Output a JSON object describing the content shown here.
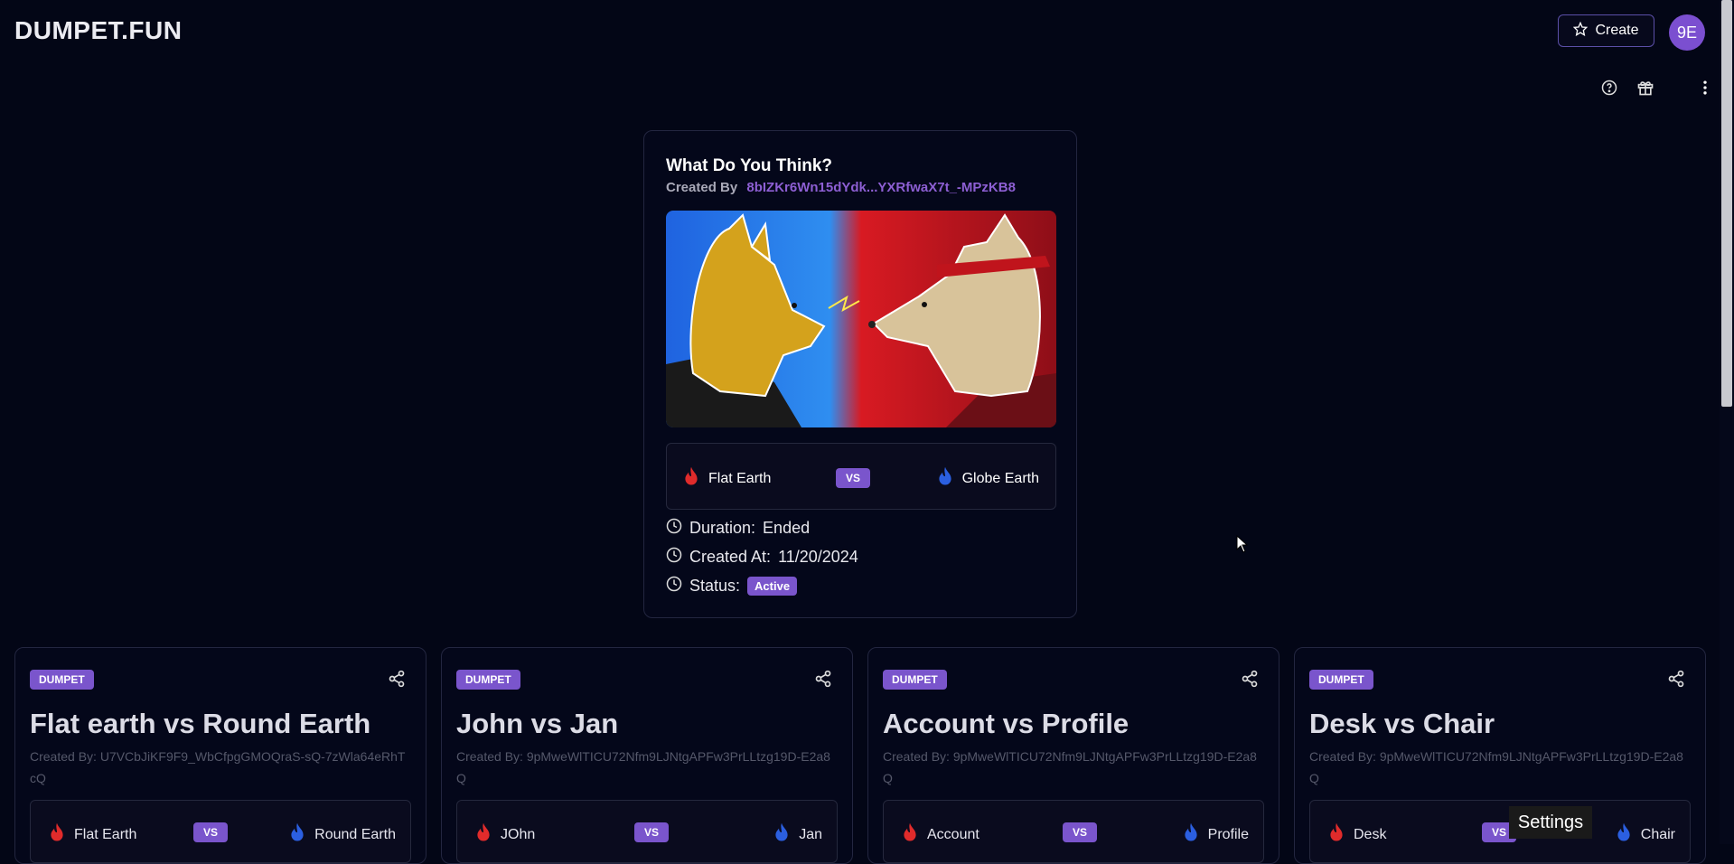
{
  "header": {
    "logo": "DUMPET.FUN",
    "create_label": "Create",
    "avatar_initials": "9E"
  },
  "feature": {
    "title": "What Do You Think?",
    "created_by_label": "Created By",
    "creator_address": "8bIZKr6Wn15dYdk...YXRfwaX7t_-MPzKB8",
    "left_option": "Flat Earth",
    "vs_label": "VS",
    "right_option": "Globe Earth",
    "duration_label": "Duration:",
    "duration_value": "Ended",
    "created_at_label": "Created At:",
    "created_at_value": "11/20/2024",
    "status_label": "Status:",
    "status_value": "Active"
  },
  "cards": [
    {
      "tag": "DUMPET",
      "title": "Flat earth vs Round Earth",
      "created_by": "Created By: U7VCbJiKF9F9_WbCfpgGMOQraS-sQ-7zWla64eRhTcQ",
      "left": "Flat Earth",
      "vs": "VS",
      "right": "Round Earth"
    },
    {
      "tag": "DUMPET",
      "title": "John vs Jan",
      "created_by": "Created By: 9pMweWlTICU72Nfm9LJNtgAPFw3PrLLtzg19D-E2a8Q",
      "left": "JOhn",
      "vs": "VS",
      "right": "Jan"
    },
    {
      "tag": "DUMPET",
      "title": "Account vs Profile",
      "created_by": "Created By: 9pMweWlTICU72Nfm9LJNtgAPFw3PrLLtzg19D-E2a8Q",
      "left": "Account",
      "vs": "VS",
      "right": "Profile"
    },
    {
      "tag": "DUMPET",
      "title": "Desk vs Chair",
      "created_by": "Created By: 9pMweWlTICU72Nfm9LJNtgAPFw3PrLLtzg19D-E2a8Q",
      "left": "Desk",
      "vs": "VS",
      "right": "Chair"
    }
  ],
  "tooltip": "Settings",
  "colors": {
    "background": "#030616",
    "accent": "#7a55cc",
    "left_flame": "#e02b2b",
    "right_flame": "#2b5fe0"
  },
  "icons": [
    "star-icon",
    "help-icon",
    "gift-icon",
    "more-vertical-icon",
    "flame-icon",
    "clock-icon",
    "share-icon"
  ]
}
